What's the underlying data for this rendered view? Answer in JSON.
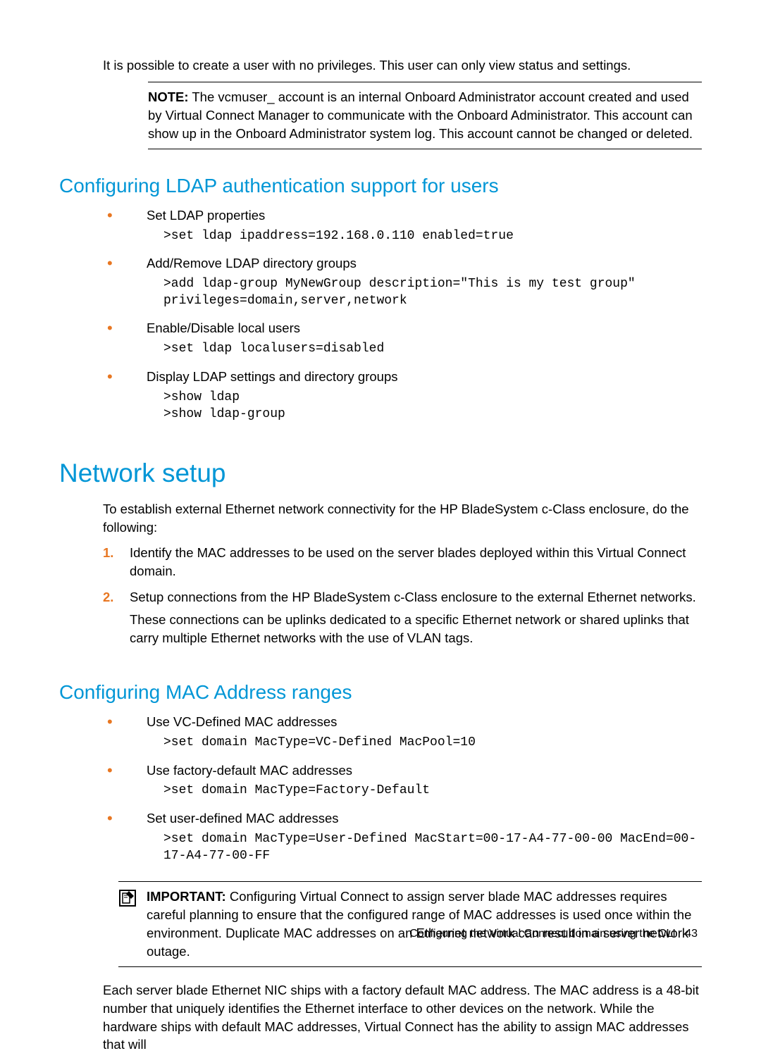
{
  "intro_para": "It is possible to create a user with no privileges. This user can only view status and settings.",
  "note": {
    "label": "NOTE:",
    "text": "  The vcmuser_ account is an internal Onboard Administrator account created and used by Virtual Connect Manager to communicate with the Onboard Administrator. This account can show up in the Onboard Administrator system log. This account cannot be changed or deleted."
  },
  "h2_ldap": "Configuring LDAP authentication support for users",
  "ldap_items": [
    {
      "label": "Set LDAP properties",
      "code": ">set ldap ipaddress=192.168.0.110 enabled=true"
    },
    {
      "label": "Add/Remove LDAP directory groups",
      "code": ">add ldap-group MyNewGroup description=\"This is my test group\" privileges=domain,server,network"
    },
    {
      "label": "Enable/Disable local users",
      "code": ">set ldap localusers=disabled"
    },
    {
      "label": "Display LDAP settings and directory groups",
      "code": ">show ldap\n>show ldap-group"
    }
  ],
  "h1_network": "Network setup",
  "network_intro": "To establish external Ethernet network connectivity for the HP BladeSystem c-Class enclosure, do the following:",
  "network_steps": [
    {
      "text": "Identify the MAC addresses to be used on the server blades deployed within this Virtual Connect domain."
    },
    {
      "text": "Setup connections from the HP BladeSystem c-Class enclosure to the external Ethernet networks.",
      "sub": "These connections can be uplinks dedicated to a specific Ethernet network or shared uplinks that carry multiple Ethernet networks with the use of VLAN tags."
    }
  ],
  "h2_mac": "Configuring MAC Address ranges",
  "mac_items": [
    {
      "label": "Use VC-Defined MAC addresses",
      "code": ">set domain MacType=VC-Defined MacPool=10"
    },
    {
      "label": "Use factory-default MAC addresses",
      "code": ">set domain MacType=Factory-Default"
    },
    {
      "label": "Set user-defined MAC addresses",
      "code": ">set domain MacType=User-Defined MacStart=00-17-A4-77-00-00 MacEnd=00-17-A4-77-00-FF"
    }
  ],
  "important": {
    "label": "IMPORTANT:",
    "text": "  Configuring Virtual Connect to assign server blade MAC addresses requires careful planning to ensure that the configured range of MAC addresses is used once within the environment. Duplicate MAC addresses on an Ethernet network can result in a server network outage."
  },
  "closing_para": "Each server blade Ethernet NIC ships with a factory default MAC address. The MAC address is a 48-bit number that uniquely identifies the Ethernet interface to other devices on the network. While the hardware ships with default MAC addresses, Virtual Connect has the ability to assign MAC addresses that will",
  "footer": {
    "title": "Configuring the Virtual Connect domain using the CLI",
    "page": "43"
  }
}
